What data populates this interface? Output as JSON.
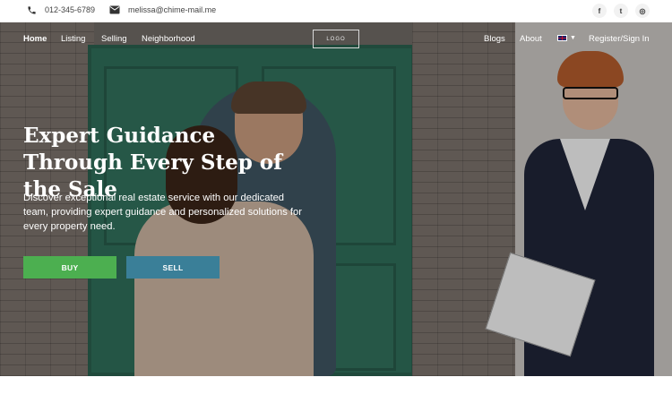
{
  "topbar": {
    "phone": "012-345-6789",
    "email": "melissa@chime-mail.me",
    "phone_icon": "phone-icon",
    "email_icon": "envelope-icon",
    "social": [
      {
        "name": "facebook-icon",
        "glyph": "f"
      },
      {
        "name": "twitter-icon",
        "glyph": "t"
      },
      {
        "name": "instagram-icon",
        "glyph": "◎"
      }
    ]
  },
  "nav": {
    "left": [
      "Home",
      "Listing",
      "Selling",
      "Neighborhood"
    ],
    "logo": "LOGO",
    "right": [
      "Blogs",
      "About"
    ],
    "language_icon": "uk-flag-icon",
    "signin": "Register/Sign In"
  },
  "hero": {
    "headline": "Expert Guidance Through Every Step of the Sale",
    "subtext": "Discover exceptional real estate service with our dedicated team, providing expert guidance and personalized solutions for every property need.",
    "buy_label": "BUY",
    "sell_label": "SELL"
  },
  "colors": {
    "buy_button": "#4caf50",
    "sell_button": "#3a7f98",
    "door": "#2f6d59"
  }
}
